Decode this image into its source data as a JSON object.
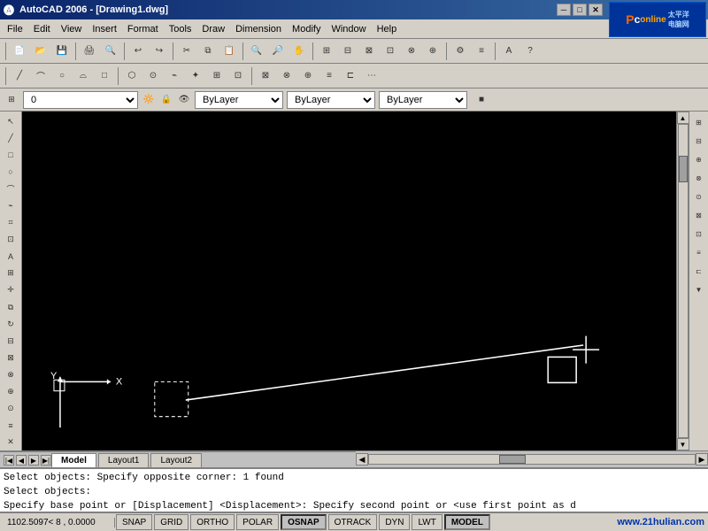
{
  "titlebar": {
    "title": "AutoCAD 2006 - [Drawing1.dwg]",
    "minimize": "─",
    "maximize": "□",
    "close": "✕"
  },
  "logo": {
    "text": "Pconline",
    "subtext": "太平洋电脑网",
    "watermark": "www.21hulian.com"
  },
  "menu": {
    "items": [
      "File",
      "Edit",
      "View",
      "Insert",
      "Format",
      "Tools",
      "Draw",
      "Dimension",
      "Modify",
      "Window",
      "Help"
    ]
  },
  "layer_bar": {
    "layer_name": "0",
    "color": "ByLayer",
    "linetype": "ByLayer",
    "lineweight": "ByLayer"
  },
  "tabs": {
    "model_label": "Model",
    "layout1_label": "Layout1",
    "layout2_label": "Layout2"
  },
  "command_lines": {
    "line1": "Select objects: Specify opposite corner: 1 found",
    "line2": "Select objects:",
    "line3": "Specify base point or [Displacement] <Displacement>: Specify second point or <use first point as d"
  },
  "status_bar": {
    "coords": "1102.5097< 8     ,  0.0000",
    "snap": "SNAP",
    "grid": "GRID",
    "ortho": "ORTHO",
    "polar": "POLAR",
    "osnap": "OSNAP",
    "otrack": "OTRACK",
    "dyn": "DYN",
    "lwt": "LWT",
    "model": "MODEL"
  },
  "toolbar_icons": {
    "new": "📄",
    "open": "📂",
    "save": "💾",
    "print": "🖨",
    "undo": "↩",
    "redo": "↪",
    "cut": "✂",
    "copy": "⧉",
    "paste": "📋",
    "zoom_in": "+",
    "zoom_out": "-",
    "pan": "✋",
    "regen": "↺"
  },
  "left_toolbar_icons": [
    "╱",
    "→",
    "□",
    "○",
    "⌒",
    "⛭",
    "✏",
    "⬡",
    "△",
    "✦",
    "⬭",
    "〄",
    "⊙",
    "⊞",
    "⊠",
    "⊡",
    "≡",
    "⊏",
    "⊗",
    "⋯"
  ],
  "right_toolbar_icons": [
    "☰",
    "⊞",
    "⊟",
    "⊕",
    "⊖",
    "⊗",
    "⊘",
    "⊙",
    "⊚",
    "⊛",
    "⊜",
    "⊝"
  ]
}
